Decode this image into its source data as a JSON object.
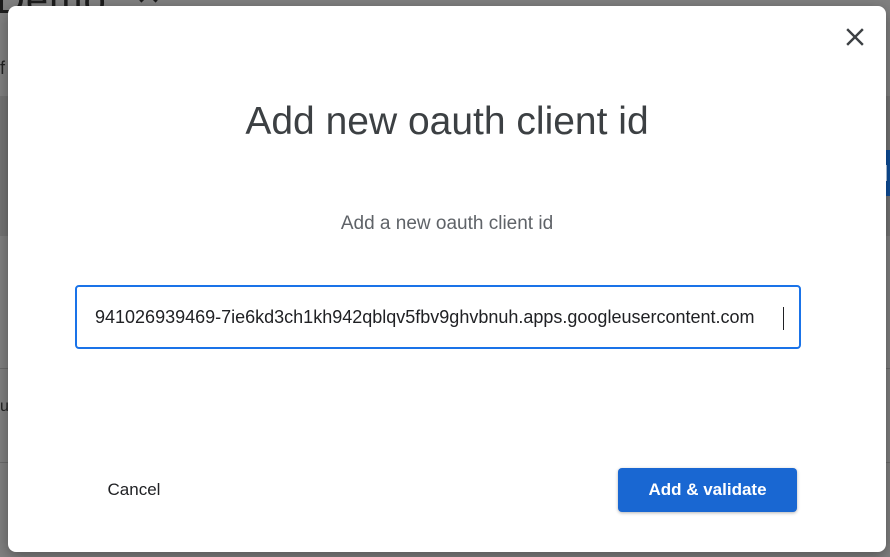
{
  "background": {
    "title_fragment": "Demo",
    "side_letters": [
      "f",
      "u"
    ]
  },
  "dialog": {
    "title": "Add new oauth client id",
    "subtitle": "Add a new oauth client id",
    "input": {
      "value": "941026939469-7ie6kd3ch1kh942qblqv5fbv9ghvbnuh.apps.googleusercontent.com",
      "placeholder": ""
    },
    "cancel_label": "Cancel",
    "submit_label": "Add & validate",
    "icons": {
      "close": "close-icon"
    }
  },
  "colors": {
    "accent": "#1967d2",
    "focus_border": "#1a73e8",
    "title_text": "#3c4043",
    "subtitle_text": "#5f6368",
    "overlay": "#808080"
  }
}
